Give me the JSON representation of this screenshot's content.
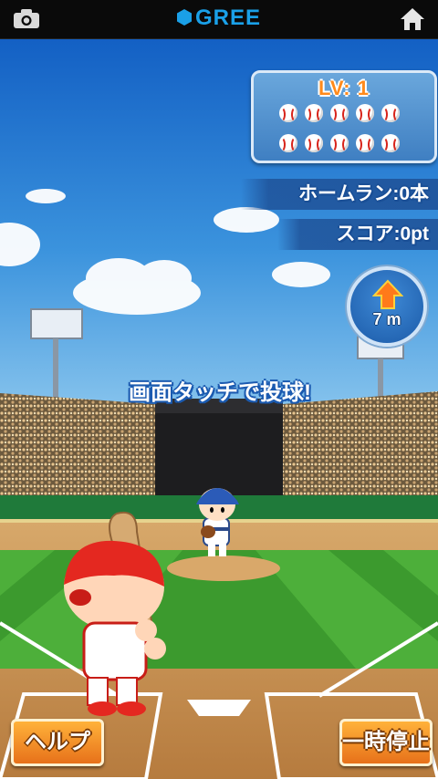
{
  "topbar": {
    "brand": "GREE",
    "camera_icon": "camera-icon",
    "home_icon": "home-icon",
    "brand_color": "#1aa0e8"
  },
  "hud": {
    "level_label": "LV: 1",
    "remaining_balls": 10,
    "homerun_label": "ホームラン:0本",
    "score_label": "スコア:0pt",
    "distance_label": "7 m"
  },
  "prompt": "画面タッチで投球!",
  "buttons": {
    "help": "ヘルプ",
    "pause": "一時停止"
  }
}
